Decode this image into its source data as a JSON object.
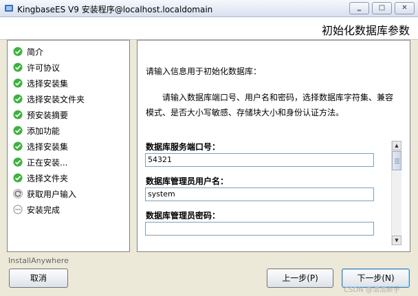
{
  "window": {
    "title": "KingbaseES V9 安装程序@localhost.localdomain",
    "minimize_glyph": "‗",
    "maximize_glyph": "□",
    "close_glyph": "✕"
  },
  "header": {
    "title": "初始化数据库参数"
  },
  "steps": [
    {
      "label": "简介",
      "status": "done",
      "icon": "check-icon"
    },
    {
      "label": "许可协议",
      "status": "done",
      "icon": "check-icon"
    },
    {
      "label": "选择安装集",
      "status": "done",
      "icon": "check-icon"
    },
    {
      "label": "选择安装文件夹",
      "status": "done",
      "icon": "check-icon"
    },
    {
      "label": "预安装摘要",
      "status": "done",
      "icon": "check-icon"
    },
    {
      "label": "添加功能",
      "status": "done",
      "icon": "check-icon"
    },
    {
      "label": "选择安装集",
      "status": "done",
      "icon": "check-icon"
    },
    {
      "label": "正在安装...",
      "status": "done",
      "icon": "check-icon"
    },
    {
      "label": "选择文件夹",
      "status": "done",
      "icon": "check-icon"
    },
    {
      "label": "获取用户输入",
      "status": "current",
      "icon": "refresh-icon"
    },
    {
      "label": "安装完成",
      "status": "pending",
      "icon": "pending-icon"
    }
  ],
  "main": {
    "intro": "请输入信息用于初始化数据库：",
    "description": "请输入数据库端口号、用户名和密码，选择数据库字符集、兼容模式、是否大小写敏感、存储块大小和身份认证方法。",
    "fields": [
      {
        "label": "数据库服务端口号：",
        "value": "54321"
      },
      {
        "label": "数据库管理员用户名：",
        "value": "system"
      },
      {
        "label": "数据库管理员密码：",
        "value": ""
      }
    ]
  },
  "footer": {
    "brand": "InstallAnywhere",
    "cancel_label": "取消",
    "prev_label": "上一步(P)",
    "next_label": "下一步(N)",
    "watermark": "CSDN @浩浩新手"
  },
  "colors": {
    "check_green": "#3eb13e",
    "accent_border": "#3c7fb1",
    "window_bg": "#ece9d8"
  }
}
